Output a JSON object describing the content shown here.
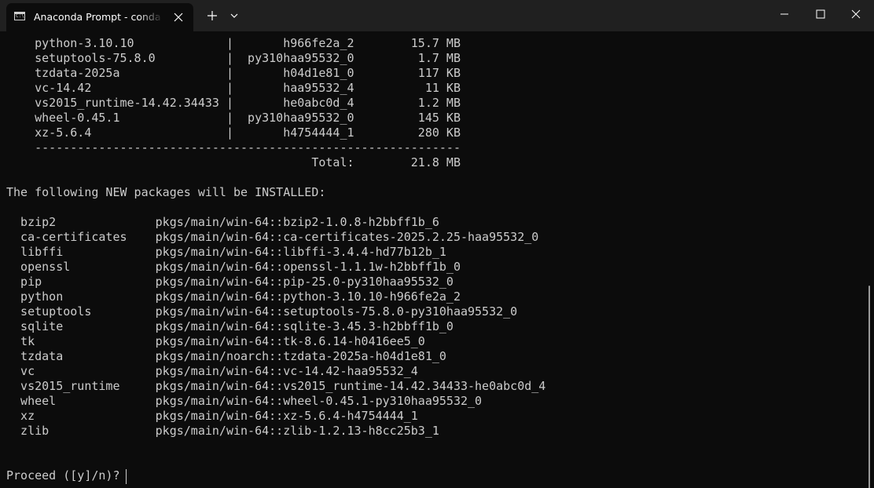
{
  "window": {
    "tab_title": "Anaconda Prompt - conda create",
    "tab_icon": "terminal-icon",
    "buttons": {
      "new_tab": "plus-icon",
      "dropdown": "chevron-down-icon",
      "minimize": "minimize-icon",
      "maximize": "maximize-icon",
      "close": "close-icon"
    }
  },
  "terminal": {
    "lines": [
      "    python-3.10.10             |       h966fe2a_2        15.7 MB",
      "    setuptools-75.8.0          |  py310haa95532_0         1.7 MB",
      "    tzdata-2025a               |       h04d1e81_0         117 KB",
      "    vc-14.42                   |       haa95532_4          11 KB",
      "    vs2015_runtime-14.42.34433 |       he0abc0d_4         1.2 MB",
      "    wheel-0.45.1               |  py310haa95532_0         145 KB",
      "    xz-5.6.4                   |       h4754444_1         280 KB",
      "    ------------------------------------------------------------",
      "                                           Total:        21.8 MB",
      "",
      "The following NEW packages will be INSTALLED:",
      "",
      "  bzip2              pkgs/main/win-64::bzip2-1.0.8-h2bbff1b_6",
      "  ca-certificates    pkgs/main/win-64::ca-certificates-2025.2.25-haa95532_0",
      "  libffi             pkgs/main/win-64::libffi-3.4.4-hd77b12b_1",
      "  openssl            pkgs/main/win-64::openssl-1.1.1w-h2bbff1b_0",
      "  pip                pkgs/main/win-64::pip-25.0-py310haa95532_0",
      "  python             pkgs/main/win-64::python-3.10.10-h966fe2a_2",
      "  setuptools         pkgs/main/win-64::setuptools-75.8.0-py310haa95532_0",
      "  sqlite             pkgs/main/win-64::sqlite-3.45.3-h2bbff1b_0",
      "  tk                 pkgs/main/win-64::tk-8.6.14-h0416ee5_0",
      "  tzdata             pkgs/main/noarch::tzdata-2025a-h04d1e81_0",
      "  vc                 pkgs/main/win-64::vc-14.42-haa95532_4",
      "  vs2015_runtime     pkgs/main/win-64::vs2015_runtime-14.42.34433-he0abc0d_4",
      "  wheel              pkgs/main/win-64::wheel-0.45.1-py310haa95532_0",
      "  xz                 pkgs/main/win-64::xz-5.6.4-h4754444_1",
      "  zlib               pkgs/main/win-64::zlib-1.2.13-h8cc25b3_1",
      "",
      "",
      "Proceed ([y]/n)? "
    ]
  },
  "colors": {
    "titlebar": "#202020",
    "terminal_bg": "#0c0c0c",
    "text": "#cccccc"
  }
}
